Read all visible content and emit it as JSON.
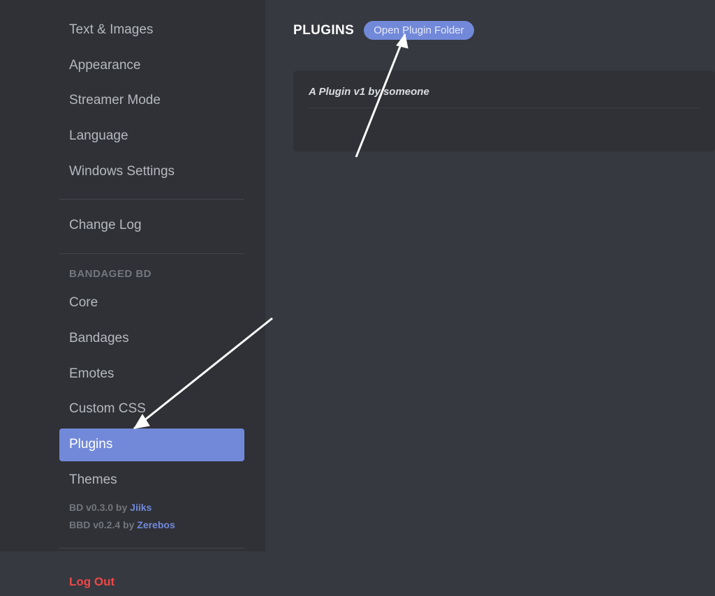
{
  "sidebar": {
    "app_settings": [
      "Text & Images",
      "Appearance",
      "Streamer Mode",
      "Language",
      "Windows Settings"
    ],
    "change_log": "Change Log",
    "section_heading": "BANDAGED BD",
    "bd_items": [
      "Core",
      "Bandages",
      "Emotes",
      "Custom CSS",
      "Plugins",
      "Themes"
    ],
    "selected_index": 4,
    "credits": [
      {
        "prefix": "BD v0.3.0 by ",
        "author": "Jiiks"
      },
      {
        "prefix": "BBD v0.2.4 by ",
        "author": "Zerebos"
      }
    ],
    "logout_label": "Log Out"
  },
  "main": {
    "page_title": "PLUGINS",
    "open_folder_label": "Open Plugin Folder",
    "plugin_heading": "A Plugin v1 by someone"
  }
}
